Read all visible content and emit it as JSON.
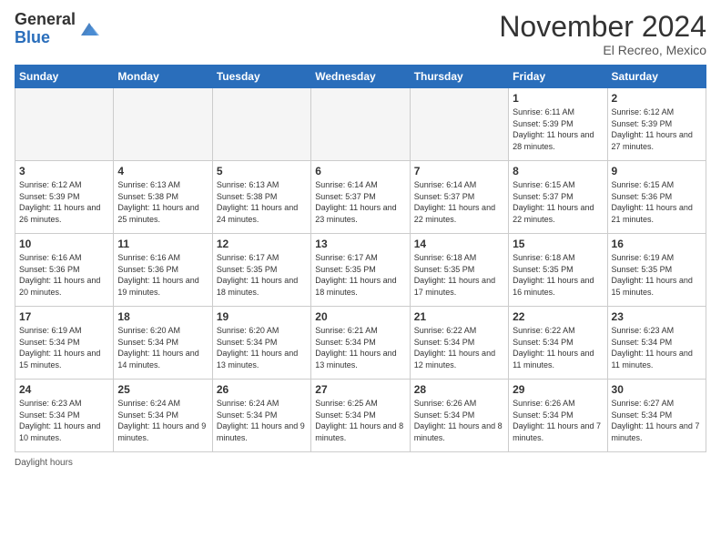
{
  "header": {
    "logo_general": "General",
    "logo_blue": "Blue",
    "month_title": "November 2024",
    "location": "El Recreo, Mexico"
  },
  "footer": {
    "label": "Daylight hours"
  },
  "weekdays": [
    "Sunday",
    "Monday",
    "Tuesday",
    "Wednesday",
    "Thursday",
    "Friday",
    "Saturday"
  ],
  "weeks": [
    [
      {
        "day": "",
        "info": ""
      },
      {
        "day": "",
        "info": ""
      },
      {
        "day": "",
        "info": ""
      },
      {
        "day": "",
        "info": ""
      },
      {
        "day": "",
        "info": ""
      },
      {
        "day": "1",
        "info": "Sunrise: 6:11 AM\nSunset: 5:39 PM\nDaylight: 11 hours\nand 28 minutes."
      },
      {
        "day": "2",
        "info": "Sunrise: 6:12 AM\nSunset: 5:39 PM\nDaylight: 11 hours\nand 27 minutes."
      }
    ],
    [
      {
        "day": "3",
        "info": "Sunrise: 6:12 AM\nSunset: 5:39 PM\nDaylight: 11 hours\nand 26 minutes."
      },
      {
        "day": "4",
        "info": "Sunrise: 6:13 AM\nSunset: 5:38 PM\nDaylight: 11 hours\nand 25 minutes."
      },
      {
        "day": "5",
        "info": "Sunrise: 6:13 AM\nSunset: 5:38 PM\nDaylight: 11 hours\nand 24 minutes."
      },
      {
        "day": "6",
        "info": "Sunrise: 6:14 AM\nSunset: 5:37 PM\nDaylight: 11 hours\nand 23 minutes."
      },
      {
        "day": "7",
        "info": "Sunrise: 6:14 AM\nSunset: 5:37 PM\nDaylight: 11 hours\nand 22 minutes."
      },
      {
        "day": "8",
        "info": "Sunrise: 6:15 AM\nSunset: 5:37 PM\nDaylight: 11 hours\nand 22 minutes."
      },
      {
        "day": "9",
        "info": "Sunrise: 6:15 AM\nSunset: 5:36 PM\nDaylight: 11 hours\nand 21 minutes."
      }
    ],
    [
      {
        "day": "10",
        "info": "Sunrise: 6:16 AM\nSunset: 5:36 PM\nDaylight: 11 hours\nand 20 minutes."
      },
      {
        "day": "11",
        "info": "Sunrise: 6:16 AM\nSunset: 5:36 PM\nDaylight: 11 hours\nand 19 minutes."
      },
      {
        "day": "12",
        "info": "Sunrise: 6:17 AM\nSunset: 5:35 PM\nDaylight: 11 hours\nand 18 minutes."
      },
      {
        "day": "13",
        "info": "Sunrise: 6:17 AM\nSunset: 5:35 PM\nDaylight: 11 hours\nand 18 minutes."
      },
      {
        "day": "14",
        "info": "Sunrise: 6:18 AM\nSunset: 5:35 PM\nDaylight: 11 hours\nand 17 minutes."
      },
      {
        "day": "15",
        "info": "Sunrise: 6:18 AM\nSunset: 5:35 PM\nDaylight: 11 hours\nand 16 minutes."
      },
      {
        "day": "16",
        "info": "Sunrise: 6:19 AM\nSunset: 5:35 PM\nDaylight: 11 hours\nand 15 minutes."
      }
    ],
    [
      {
        "day": "17",
        "info": "Sunrise: 6:19 AM\nSunset: 5:34 PM\nDaylight: 11 hours\nand 15 minutes."
      },
      {
        "day": "18",
        "info": "Sunrise: 6:20 AM\nSunset: 5:34 PM\nDaylight: 11 hours\nand 14 minutes."
      },
      {
        "day": "19",
        "info": "Sunrise: 6:20 AM\nSunset: 5:34 PM\nDaylight: 11 hours\nand 13 minutes."
      },
      {
        "day": "20",
        "info": "Sunrise: 6:21 AM\nSunset: 5:34 PM\nDaylight: 11 hours\nand 13 minutes."
      },
      {
        "day": "21",
        "info": "Sunrise: 6:22 AM\nSunset: 5:34 PM\nDaylight: 11 hours\nand 12 minutes."
      },
      {
        "day": "22",
        "info": "Sunrise: 6:22 AM\nSunset: 5:34 PM\nDaylight: 11 hours\nand 11 minutes."
      },
      {
        "day": "23",
        "info": "Sunrise: 6:23 AM\nSunset: 5:34 PM\nDaylight: 11 hours\nand 11 minutes."
      }
    ],
    [
      {
        "day": "24",
        "info": "Sunrise: 6:23 AM\nSunset: 5:34 PM\nDaylight: 11 hours\nand 10 minutes."
      },
      {
        "day": "25",
        "info": "Sunrise: 6:24 AM\nSunset: 5:34 PM\nDaylight: 11 hours\nand 9 minutes."
      },
      {
        "day": "26",
        "info": "Sunrise: 6:24 AM\nSunset: 5:34 PM\nDaylight: 11 hours\nand 9 minutes."
      },
      {
        "day": "27",
        "info": "Sunrise: 6:25 AM\nSunset: 5:34 PM\nDaylight: 11 hours\nand 8 minutes."
      },
      {
        "day": "28",
        "info": "Sunrise: 6:26 AM\nSunset: 5:34 PM\nDaylight: 11 hours\nand 8 minutes."
      },
      {
        "day": "29",
        "info": "Sunrise: 6:26 AM\nSunset: 5:34 PM\nDaylight: 11 hours\nand 7 minutes."
      },
      {
        "day": "30",
        "info": "Sunrise: 6:27 AM\nSunset: 5:34 PM\nDaylight: 11 hours\nand 7 minutes."
      }
    ]
  ]
}
